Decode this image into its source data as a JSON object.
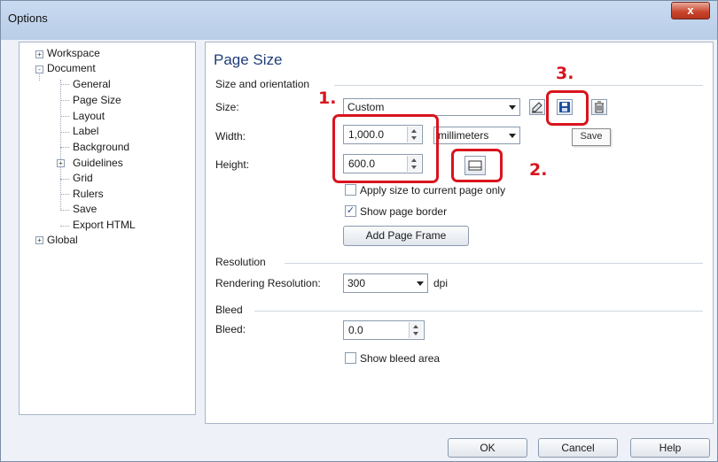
{
  "window": {
    "title": "Options",
    "close_glyph": "x"
  },
  "tree": {
    "items": [
      "Workspace",
      "Document",
      "General",
      "Page Size",
      "Layout",
      "Label",
      "Background",
      "Guidelines",
      "Grid",
      "Rulers",
      "Save",
      "Export HTML",
      "Global"
    ],
    "expanders": {
      "workspace": "+",
      "document": "-",
      "guidelines": "+",
      "global": "+"
    }
  },
  "panel": {
    "heading": "Page Size",
    "size_section": {
      "title": "Size and orientation",
      "size_label": "Size:",
      "size_value": "Custom",
      "width_label": "Width:",
      "width_value": "1,000.0",
      "units_value": "millimeters",
      "height_label": "Height:",
      "height_value": "600.0",
      "apply_label": "Apply size to current page only",
      "apply_checked": false,
      "border_label": "Show page border",
      "border_checked": true,
      "add_frame_label": "Add Page Frame",
      "tooltip": "Save"
    },
    "resolution_section": {
      "title": "Resolution",
      "rendering_label": "Rendering Resolution:",
      "rendering_value": "300",
      "unit": "dpi"
    },
    "bleed_section": {
      "title": "Bleed",
      "bleed_label": "Bleed:",
      "bleed_value": "0.0",
      "show_bleed_label": "Show bleed area",
      "show_bleed_checked": false
    }
  },
  "annotations": [
    "1.",
    "2.",
    "3."
  ],
  "footer": {
    "ok": "OK",
    "cancel": "Cancel",
    "help": "Help"
  },
  "colors": {
    "annotation": "#d8141e",
    "heading": "#1f3d7a"
  },
  "icons": [
    "tree-expand-icon",
    "tree-collapse-icon",
    "edit-page-size-icon",
    "save-icon",
    "delete-icon",
    "landscape-orientation-icon",
    "checkmark-icon",
    "dropdown-arrow-icon",
    "spin-up-icon",
    "spin-down-icon"
  ]
}
